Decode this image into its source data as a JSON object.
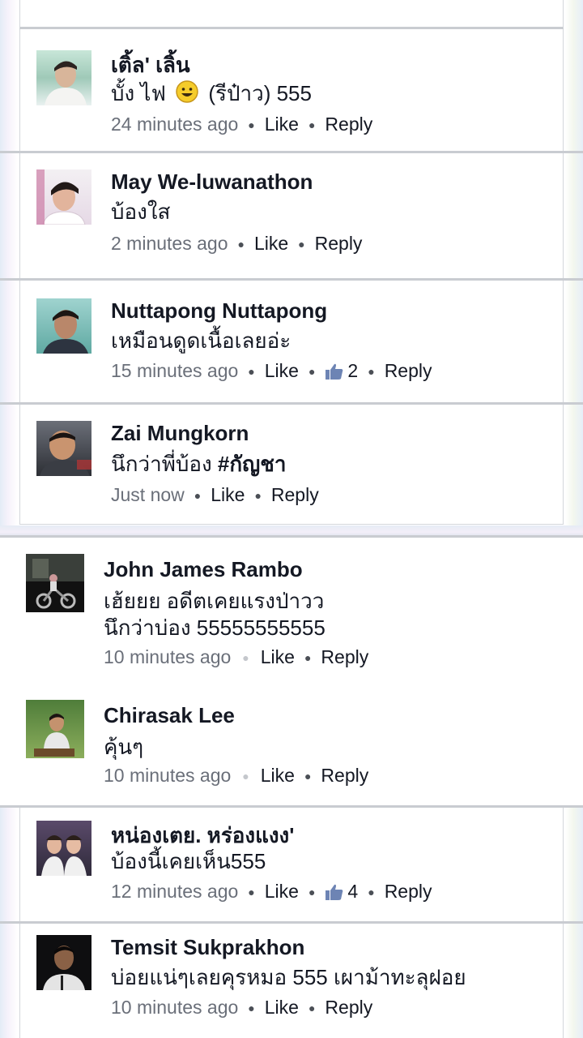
{
  "comments": [
    {
      "name": "เติ้ล' เลิ้น",
      "text_before": "บั้ง ไฟ",
      "emoji": "smile-emoji",
      "text_after": "(รีป๋าว) 555",
      "time": "24 minutes ago",
      "like": "Like",
      "reply": "Reply"
    },
    {
      "name": "May We-luwanathon",
      "text": "บ้องใส",
      "time": "2 minutes ago",
      "like": "Like",
      "reply": "Reply"
    },
    {
      "name": "Nuttapong Nuttapong",
      "text": "เหมือนดูดเนื้อเลยอ่ะ",
      "time": "15 minutes ago",
      "like": "Like",
      "likes_count": "2",
      "reply": "Reply"
    },
    {
      "name": "Zai Mungkorn",
      "text_plain": "นึกว่าพี่บ้อง ",
      "hashtag": "#กัญชา",
      "time": "Just now",
      "like": "Like",
      "reply": "Reply"
    },
    {
      "name": "John James Rambo",
      "text_line1": "เฮ้ยยย อดีตเคยแรงป่าวว",
      "text_line2": "นึกว่าบ่อง 55555555555",
      "time": "10 minutes ago",
      "like": "Like",
      "reply": "Reply"
    },
    {
      "name": "Chirasak Lee",
      "text": "คุ้นๆ",
      "time": "10 minutes ago",
      "like": "Like",
      "reply": "Reply"
    },
    {
      "name": "หน่องเตย. หร่องแงง'",
      "text": "บ้องนี้เคยเห็น555",
      "time": "12 minutes ago",
      "like": "Like",
      "likes_count": "4",
      "reply": "Reply"
    },
    {
      "name": "Temsit Sukprakhon",
      "text": "บ่อยแน่ๆเลยคุรหมอ 555 เผาม้าทะลุฝอย",
      "time": "10 minutes ago",
      "like": "Like",
      "reply": "Reply"
    }
  ],
  "colors": {
    "text": "#141823",
    "meta": "#6a6f79",
    "divider": "#c9ccd1",
    "like_icon": "#6d84b4"
  }
}
